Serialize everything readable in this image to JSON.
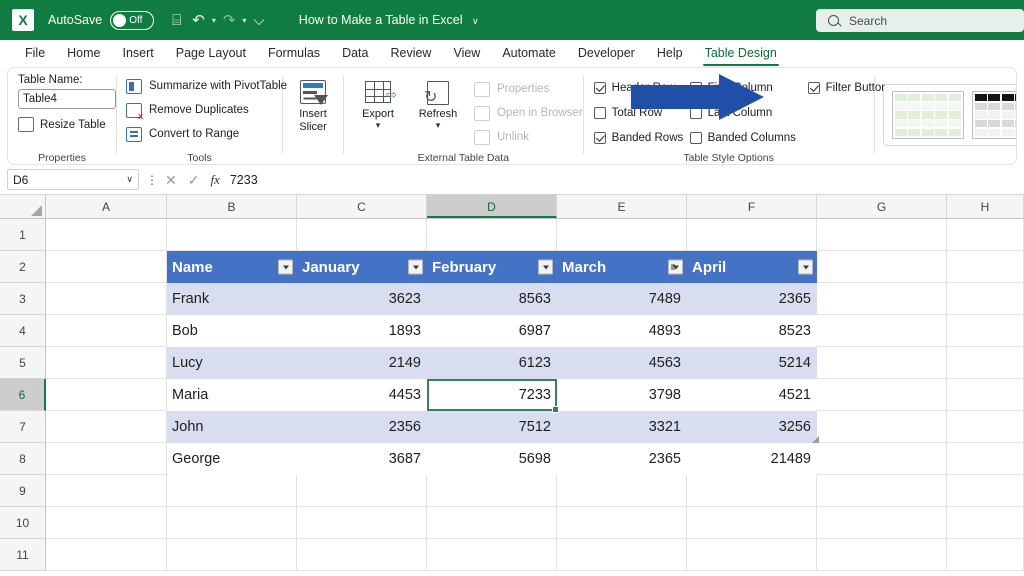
{
  "titlebar": {
    "app_icon": "excel-logo",
    "autosave_label": "AutoSave",
    "autosave_state": "Off",
    "qat": [
      {
        "name": "save-icon",
        "glyph": "⌸"
      },
      {
        "name": "undo-icon",
        "glyph": "↶"
      },
      {
        "name": "redo-icon",
        "glyph": "↷"
      },
      {
        "name": "customize-qat-icon",
        "glyph": "⌵"
      }
    ],
    "document_title": "How to Make a Table in Excel",
    "title_chevron": "∨",
    "search_placeholder": "Search",
    "background_color": "#107C41"
  },
  "tabs": [
    {
      "label": "File",
      "active": false
    },
    {
      "label": "Home",
      "active": false
    },
    {
      "label": "Insert",
      "active": false
    },
    {
      "label": "Page Layout",
      "active": false
    },
    {
      "label": "Formulas",
      "active": false
    },
    {
      "label": "Data",
      "active": false
    },
    {
      "label": "Review",
      "active": false
    },
    {
      "label": "View",
      "active": false
    },
    {
      "label": "Automate",
      "active": false
    },
    {
      "label": "Developer",
      "active": false
    },
    {
      "label": "Help",
      "active": false
    },
    {
      "label": "Table Design",
      "active": true
    }
  ],
  "ribbon": {
    "properties": {
      "group_label": "Properties",
      "table_name_caption": "Table Name:",
      "table_name_value": "Table4",
      "resize_table_label": "Resize Table"
    },
    "tools": {
      "group_label": "Tools",
      "items": [
        "Summarize with PivotTable",
        "Remove Duplicates",
        "Convert to Range"
      ]
    },
    "slicer": {
      "label_line1": "Insert",
      "label_line2": "Slicer"
    },
    "external": {
      "group_label": "External Table Data",
      "export_label": "Export",
      "refresh_label": "Refresh",
      "dim_items": [
        "Properties",
        "Open in Browser",
        "Unlink"
      ]
    },
    "table_style_options": {
      "group_label": "Table Style Options",
      "checkboxes": [
        {
          "label": "Header Row",
          "checked": true
        },
        {
          "label": "First Column",
          "checked": false
        },
        {
          "label": "Filter Button",
          "checked": true
        },
        {
          "label": "Total Row",
          "checked": false
        },
        {
          "label": "Last Column",
          "checked": false
        },
        {
          "label": "Banded Rows",
          "checked": true
        },
        {
          "label": "Banded Columns",
          "checked": false
        }
      ]
    },
    "gallery": {
      "styles": [
        "light-green",
        "dark-black",
        "blue-selected"
      ],
      "selected_index": 2
    },
    "annotation_arrow": {
      "color": "#1F4FA8",
      "points_to": "Filter Button"
    }
  },
  "formula_bar": {
    "name_box_value": "D6",
    "name_box_chevron": "∨",
    "cancel_icon": "✕",
    "enter_icon": "✓",
    "function_icon": "fx",
    "formula_value": "7233"
  },
  "grid": {
    "columns": [
      "A",
      "B",
      "C",
      "D",
      "E",
      "F",
      "G",
      "H"
    ],
    "selected_column": "D",
    "rows": [
      "1",
      "2",
      "3",
      "4",
      "5",
      "6",
      "7",
      "8",
      "9",
      "10",
      "11"
    ],
    "selected_row": "6",
    "selected_cell": "D6"
  },
  "chart_data": {
    "type": "table",
    "title": "Table4",
    "headers": [
      "Name",
      "January",
      "February",
      "March",
      "April"
    ],
    "rows": [
      [
        "Frank",
        "3623",
        "8563",
        "7489",
        "2365"
      ],
      [
        "Bob",
        "1893",
        "6987",
        "4893",
        "8523"
      ],
      [
        "Lucy",
        "2149",
        "6123",
        "4563",
        "5214"
      ],
      [
        "Maria",
        "4453",
        "7233",
        "3798",
        "4521"
      ],
      [
        "John",
        "2356",
        "7512",
        "3321",
        "3256"
      ],
      [
        "George",
        "3687",
        "5698",
        "2365",
        "21489"
      ]
    ],
    "header_row_index": "2",
    "first_data_row_index": "3",
    "header_color": "#4472C4",
    "band_color": "#D9DDF0",
    "filter_buttons_visible": true
  }
}
